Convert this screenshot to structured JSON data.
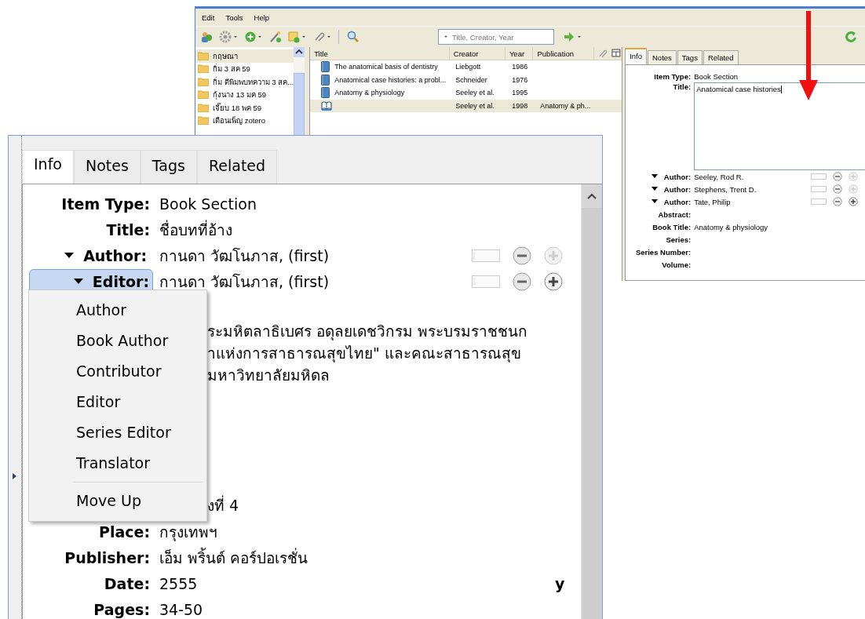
{
  "background_window": {
    "menu": [
      "Edit",
      "Tools",
      "Help"
    ],
    "search": {
      "placeholder": "Title, Creator, Year"
    },
    "collections": [
      {
        "name": "กฤษณา",
        "selected": true
      },
      {
        "name": "กิ่ม 3 สค 59",
        "selected": false
      },
      {
        "name": "กิ่ม ตีพิมพบทความ 3 สค...",
        "selected": false
      },
      {
        "name": "กุ้งนาง 13 มค 59",
        "selected": false
      },
      {
        "name": "เจี๊ยบ 18 พค 59",
        "selected": false
      },
      {
        "name": "เดือนเพ็ญ zotero",
        "selected": false
      }
    ],
    "items": {
      "columns": [
        "Title",
        "Creator",
        "Year",
        "Publication"
      ],
      "rows": [
        {
          "kind": "book",
          "title": "The anatomical basis of dentistry",
          "creator": "Liebgott",
          "year": "1986",
          "selected": false
        },
        {
          "kind": "book",
          "title": "Anatomical case histories: a probl...",
          "creator": "Schneider",
          "year": "1976",
          "selected": false
        },
        {
          "kind": "book",
          "title": "Anatomy & physiology",
          "creator": "Seeley et al.",
          "year": "1995",
          "selected": false
        },
        {
          "kind": "book-section",
          "creator": "Seeley et al.",
          "year": "1998",
          "publication": "Anatomy & ph...",
          "selected": true
        }
      ]
    },
    "item_pane": {
      "tabs": [
        {
          "label": "Info",
          "selected": true
        },
        {
          "label": "Notes",
          "selected": false
        },
        {
          "label": "Tags",
          "selected": false
        },
        {
          "label": "Related",
          "selected": false
        }
      ],
      "fields": [
        {
          "kind": "field",
          "label": "Item Type:",
          "value": "Book Section"
        },
        {
          "kind": "textarea",
          "label": "Title:",
          "value": "Anatomical case histories"
        },
        {
          "kind": "creator",
          "label": "Author:",
          "value": "Seeley, Rod R.",
          "plus_enabled": false
        },
        {
          "kind": "creator",
          "label": "Author:",
          "value": "Stephens, Trent D.",
          "plus_enabled": false
        },
        {
          "kind": "creator",
          "label": "Author:",
          "value": "Tate, Philip",
          "plus_enabled": true
        },
        {
          "kind": "field",
          "label": "Abstract:"
        },
        {
          "kind": "field",
          "label": "Book Title:",
          "value": "Anatomy & physiology"
        },
        {
          "kind": "field",
          "label": "Series:"
        },
        {
          "kind": "field",
          "label": "Series Number:"
        },
        {
          "kind": "field",
          "label": "Volume:"
        }
      ]
    }
  },
  "zoomed_panel": {
    "tabs": [
      {
        "label": "Info",
        "selected": true
      },
      {
        "label": "Notes",
        "selected": false
      },
      {
        "label": "Tags",
        "selected": false
      },
      {
        "label": "Related",
        "selected": false
      }
    ],
    "fields": [
      {
        "kind": "field",
        "label": "Item Type:",
        "value": "Book Section"
      },
      {
        "kind": "field",
        "label": "Title:",
        "value": "ชื่อบทที่อ้าง"
      },
      {
        "kind": "creator",
        "label": "Author:",
        "value": "กานดา วัฒโนภาส, (first)",
        "plus_enabled": false,
        "active": false
      },
      {
        "kind": "creator",
        "label": "Editor:",
        "value": "กานดา วัฒโนภาส, (first)",
        "plus_enabled": true,
        "active": true
      },
      {
        "kind": "obscured",
        "lines": [
          "ระมหิตลาธิเบศร อดุลยเดชวิกรม พระบรมราชชนก",
          "าแห่งการสาธารณสุขไทย\" และคณะสาธารณสุข",
          "มหาวิทยาลัยมหิดล"
        ]
      },
      {
        "kind": "obscured",
        "lines": [
          "งที่ 4"
        ]
      },
      {
        "kind": "field",
        "label": "Place:",
        "value": "กรุงเทพฯ"
      },
      {
        "kind": "field",
        "label": "Publisher:",
        "value": "เอ็ม พริ้นต์ คอร์ปอเรชั่น"
      },
      {
        "kind": "field",
        "label": "Date:",
        "value": "2555",
        "suffix": "y"
      },
      {
        "kind": "field",
        "label": "Pages:",
        "value": "34-50"
      }
    ],
    "creator_menu": {
      "items": [
        "Author",
        "Book Author",
        "Contributor",
        "Editor",
        "Series Editor",
        "Translator"
      ],
      "extra_items": [
        "Move Up"
      ]
    }
  }
}
